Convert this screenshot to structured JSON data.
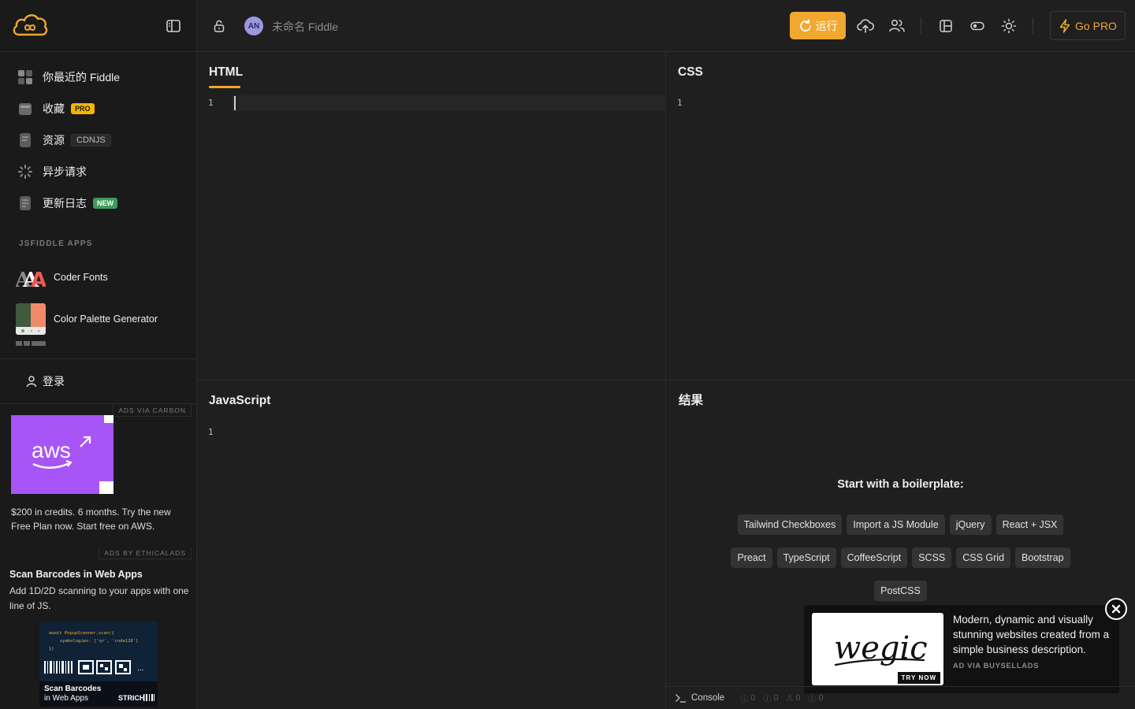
{
  "sidebar": {
    "nav": [
      {
        "label": "你最近的 Fiddle",
        "icon": "grid-icon"
      },
      {
        "label": "收藏",
        "badge": "PRO",
        "icon": "archive-icon"
      },
      {
        "label": "资源",
        "badge": "CDNJS",
        "icon": "file-icon"
      },
      {
        "label": "异步请求",
        "icon": "loader-icon"
      },
      {
        "label": "更新日志",
        "badge": "NEW",
        "icon": "document-icon"
      }
    ],
    "apps_title": "JSFIDDLE APPS",
    "apps": [
      {
        "label": "Coder Fonts"
      },
      {
        "label": "Color Palette Generator"
      }
    ],
    "login_label": "登录",
    "ad_carbon": {
      "label": "ADS VIA CARBON",
      "logo_text": "aws",
      "text": "$200 in credits. 6 months. Try the new Free Plan now. Start free on AWS."
    },
    "ad_ethical": {
      "label": "ADS BY ETHICALADS",
      "title": "Scan Barcodes in Web Apps",
      "text": "Add 1D/2D scanning to your apps with one line of JS.",
      "code_line1": "await PopupScanner.scan({",
      "code_line2": "symbologies: ['qr', 'code128']",
      "code_line3": "})",
      "img_title1": "Scan Barcodes",
      "img_title2": "in Web Apps",
      "img_brand": "STRICH"
    }
  },
  "topbar": {
    "avatar": "AN",
    "fiddle_name": "未命名 Fiddle",
    "run_label": "运行",
    "gopro_label": "Go PRO"
  },
  "panels": {
    "html": {
      "title": "HTML",
      "line": "1"
    },
    "css": {
      "title": "CSS",
      "line": "1"
    },
    "js": {
      "title": "JavaScript",
      "line": "1"
    },
    "result": {
      "title": "结果"
    }
  },
  "boilerplate": {
    "title": "Start with a boilerplate:",
    "rows": [
      [
        "Tailwind Checkboxes",
        "Import a JS Module",
        "jQuery",
        "React + JSX"
      ],
      [
        "Preact",
        "TypeScript",
        "CoffeeScript",
        "SCSS",
        "CSS Grid",
        "Bootstrap"
      ],
      [
        "PostCSS"
      ]
    ]
  },
  "ad_popup": {
    "logo_text": "wegic",
    "try_label": "TRY NOW",
    "text": "Modern, dynamic and visually stunning websites created from a simple business description.",
    "via": "AD VIA BUYSELLADS"
  },
  "console": {
    "label": "Console",
    "counts": [
      "0",
      "0",
      "0",
      "0"
    ]
  },
  "colors": {
    "accent": "#f0a830",
    "background": "#1f1f1f",
    "sidebar": "#1a1a1a"
  }
}
